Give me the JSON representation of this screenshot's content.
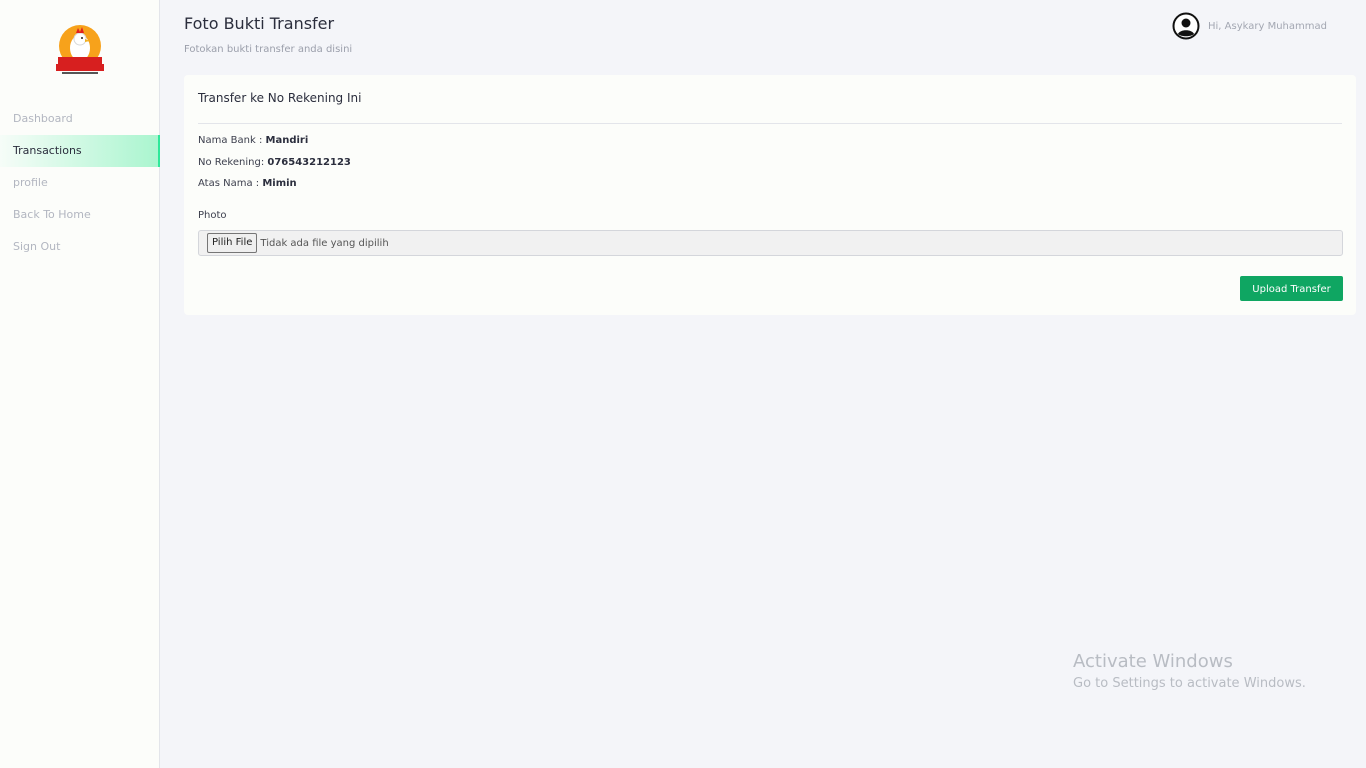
{
  "sidebar": {
    "logo_text": "CHICKEN",
    "items": [
      {
        "label": "Dashboard"
      },
      {
        "label": "Transactions"
      },
      {
        "label": "profile"
      },
      {
        "label": "Back To Home"
      },
      {
        "label": "Sign Out"
      }
    ]
  },
  "header": {
    "title": "Foto Bukti Transfer",
    "subtitle": "Fotokan bukti transfer anda disini",
    "user_greeting": "Hi, Asykary Muhammad",
    "user_icon": "user-circle-icon"
  },
  "card": {
    "title": "Transfer ke No Rekening Ini",
    "bank_label": "Nama Bank :",
    "bank_value": "Mandiri",
    "account_label": "No Rekening:",
    "account_value": "076543212123",
    "holder_label": "Atas Nama :",
    "holder_value": "Mimin",
    "photo_label": "Photo",
    "file_button": "Pilih File",
    "file_status": "Tidak ada file yang dipilih",
    "upload_button": "Upload Transfer"
  },
  "watermark": {
    "title": "Activate Windows",
    "subtitle": "Go to Settings to activate Windows."
  },
  "colors": {
    "accent": "#2ee89a",
    "button": "#0fa662",
    "background": "#f4f5f9"
  }
}
